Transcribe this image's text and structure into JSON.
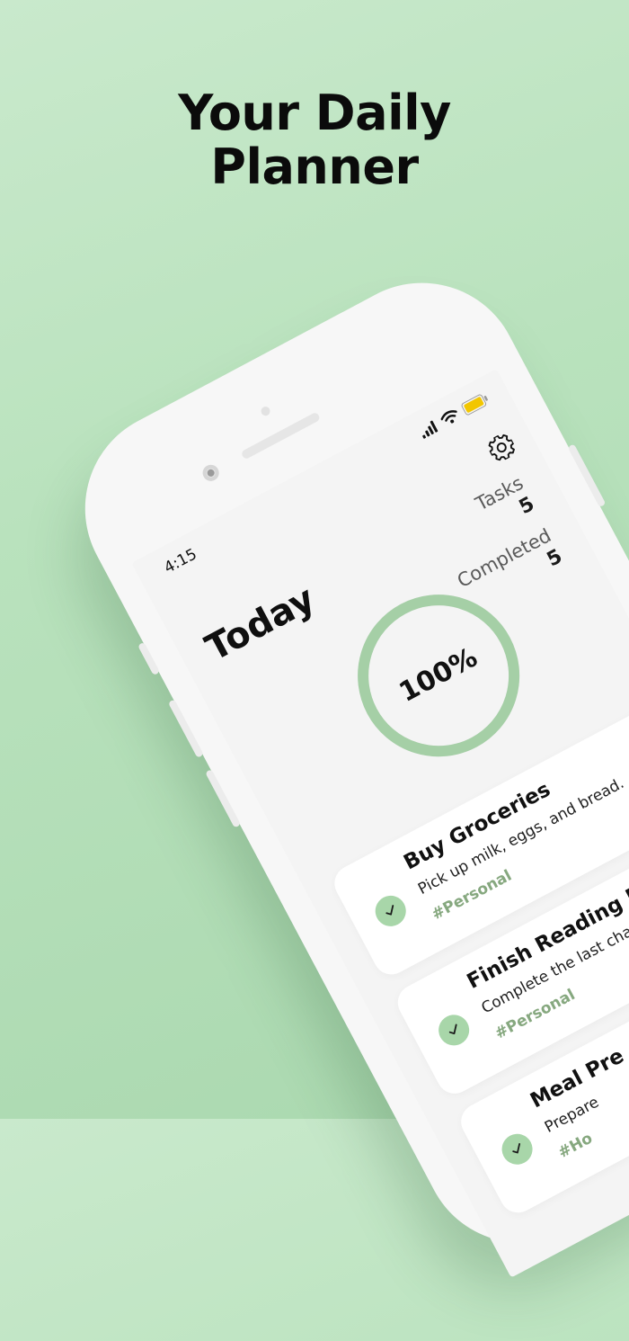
{
  "headline": {
    "line1": "Your Daily",
    "line2": "Planner"
  },
  "status_bar": {
    "time": "4:15",
    "icons": [
      "cellular-signal-icon",
      "wifi-icon",
      "battery-icon"
    ]
  },
  "header": {
    "title": "Today",
    "settings_icon": "gear-icon"
  },
  "stats": {
    "tasks_label": "Tasks",
    "tasks_value": "5",
    "completed_label": "Completed",
    "completed_value": "5"
  },
  "progress": {
    "label": "100%",
    "fraction": 1.0
  },
  "tasks": [
    {
      "title": "Buy Groceries",
      "description": "Pick up milk, eggs, and bread.",
      "tag": "#Personal",
      "completed": true
    },
    {
      "title": "Finish Reading Boo",
      "description": "Complete the last cha",
      "tag": "#Personal",
      "completed": true
    },
    {
      "title": "Meal Pre",
      "description": "Prepare",
      "tag": "#Ho",
      "completed": true
    }
  ],
  "colors": {
    "background": "#b9e2bd",
    "accent": "#a8d6a9",
    "tag": "#86a87f",
    "ring": "#a5cfa6"
  }
}
